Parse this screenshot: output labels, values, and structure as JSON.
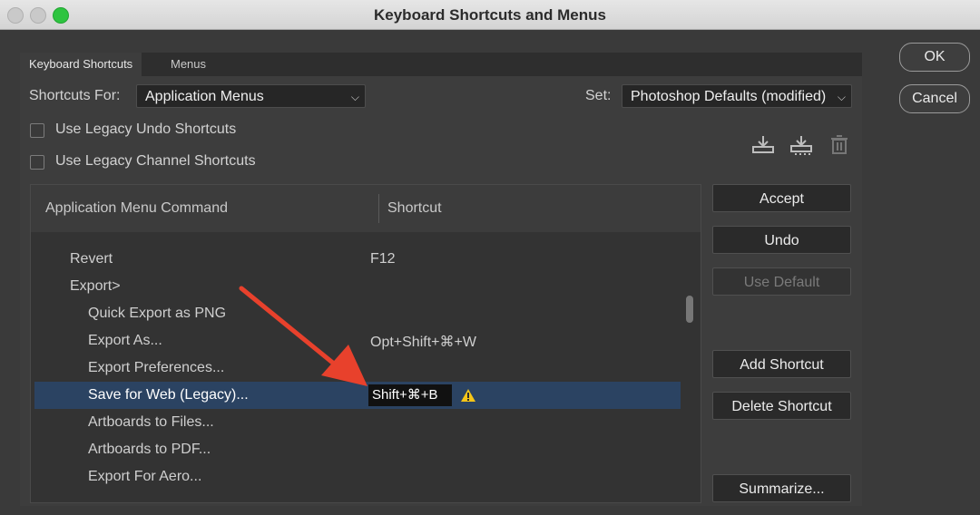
{
  "window": {
    "title": "Keyboard Shortcuts and Menus"
  },
  "tabs": [
    {
      "label": "Keyboard Shortcuts"
    },
    {
      "label": "Menus"
    }
  ],
  "shortcuts_for": {
    "label": "Shortcuts For:",
    "value": "Application Menus"
  },
  "set": {
    "label": "Set:",
    "value": "Photoshop Defaults (modified)"
  },
  "options": [
    {
      "label": "Use Legacy Undo Shortcuts",
      "checked": false
    },
    {
      "label": "Use Legacy Channel Shortcuts",
      "checked": false
    }
  ],
  "set_icons": [
    "save-set-icon",
    "save-as-set-icon",
    "trash-icon"
  ],
  "table": {
    "headers": {
      "command": "Application Menu Command",
      "shortcut": "Shortcut"
    },
    "rows": [
      {
        "command": "Revert",
        "shortcut": "F12",
        "indent": 1
      },
      {
        "command": "Export>",
        "shortcut": "",
        "indent": 1
      },
      {
        "command": "Quick Export as PNG",
        "shortcut": "",
        "indent": 2
      },
      {
        "command": "Export As...",
        "shortcut": "Opt+Shift+⌘+W",
        "indent": 2
      },
      {
        "command": "Export Preferences...",
        "shortcut": "",
        "indent": 2
      },
      {
        "command": "Save for Web (Legacy)...",
        "shortcut": "Shift+⌘+B",
        "indent": 2,
        "selected": true,
        "warning": true
      },
      {
        "command": "Artboards to Files...",
        "shortcut": "",
        "indent": 2
      },
      {
        "command": "Artboards to PDF...",
        "shortcut": "",
        "indent": 2
      },
      {
        "command": "Export For Aero...",
        "shortcut": "",
        "indent": 2
      }
    ]
  },
  "buttons": {
    "accept": "Accept",
    "undo": "Undo",
    "use_default": "Use Default",
    "add_shortcut": "Add Shortcut",
    "delete_shortcut": "Delete Shortcut",
    "summarize": "Summarize..."
  },
  "dialog_buttons": {
    "ok": "OK",
    "cancel": "Cancel"
  },
  "colors": {
    "arrow": "#e8412c",
    "warning": "#f5c518",
    "selection": "#2b4362"
  }
}
